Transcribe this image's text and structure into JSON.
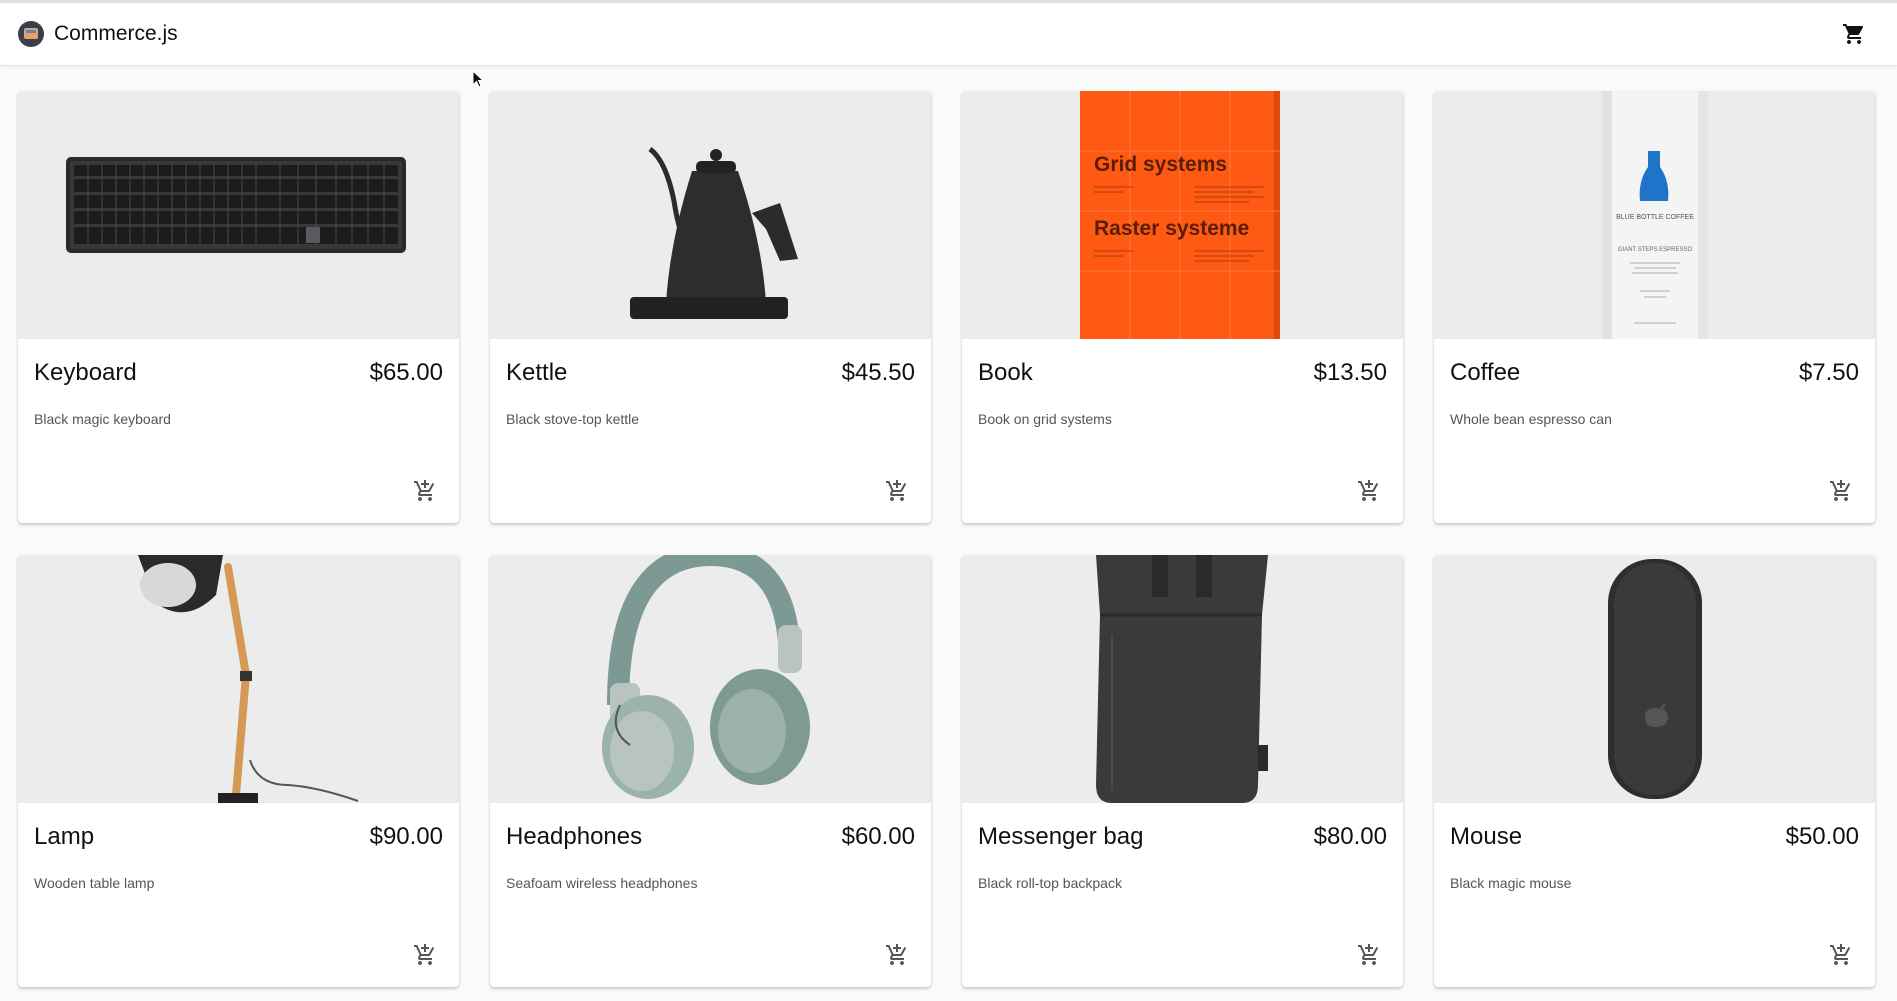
{
  "header": {
    "title": "Commerce.js",
    "logo_icon": "commercejs-logo-icon",
    "cart_icon": "shopping-cart-icon"
  },
  "products": [
    {
      "name": "Keyboard",
      "price": "$65.00",
      "description": "Black magic keyboard"
    },
    {
      "name": "Kettle",
      "price": "$45.50",
      "description": "Black stove-top kettle"
    },
    {
      "name": "Book",
      "price": "$13.50",
      "description": "Book on grid systems",
      "cover": {
        "line1": "Grid systems",
        "line2": "Raster systeme"
      }
    },
    {
      "name": "Coffee",
      "price": "$7.50",
      "description": "Whole bean espresso can",
      "label": {
        "brand": "BLUE BOTTLE COFFEE",
        "blend": "GIANT STEPS ESPRESSO"
      }
    },
    {
      "name": "Lamp",
      "price": "$90.00",
      "description": "Wooden table lamp"
    },
    {
      "name": "Headphones",
      "price": "$60.00",
      "description": "Seafoam wireless headphones"
    },
    {
      "name": "Messenger bag",
      "price": "$80.00",
      "description": "Black roll-top backpack"
    },
    {
      "name": "Mouse",
      "price": "$50.00",
      "description": "Black magic mouse"
    }
  ],
  "add_to_cart_icon": "add-shopping-cart-icon",
  "colors": {
    "appbar": "#ffffff",
    "background": "#fafafa",
    "image_bg": "#ececec",
    "book_cover": "#ff5a14"
  }
}
